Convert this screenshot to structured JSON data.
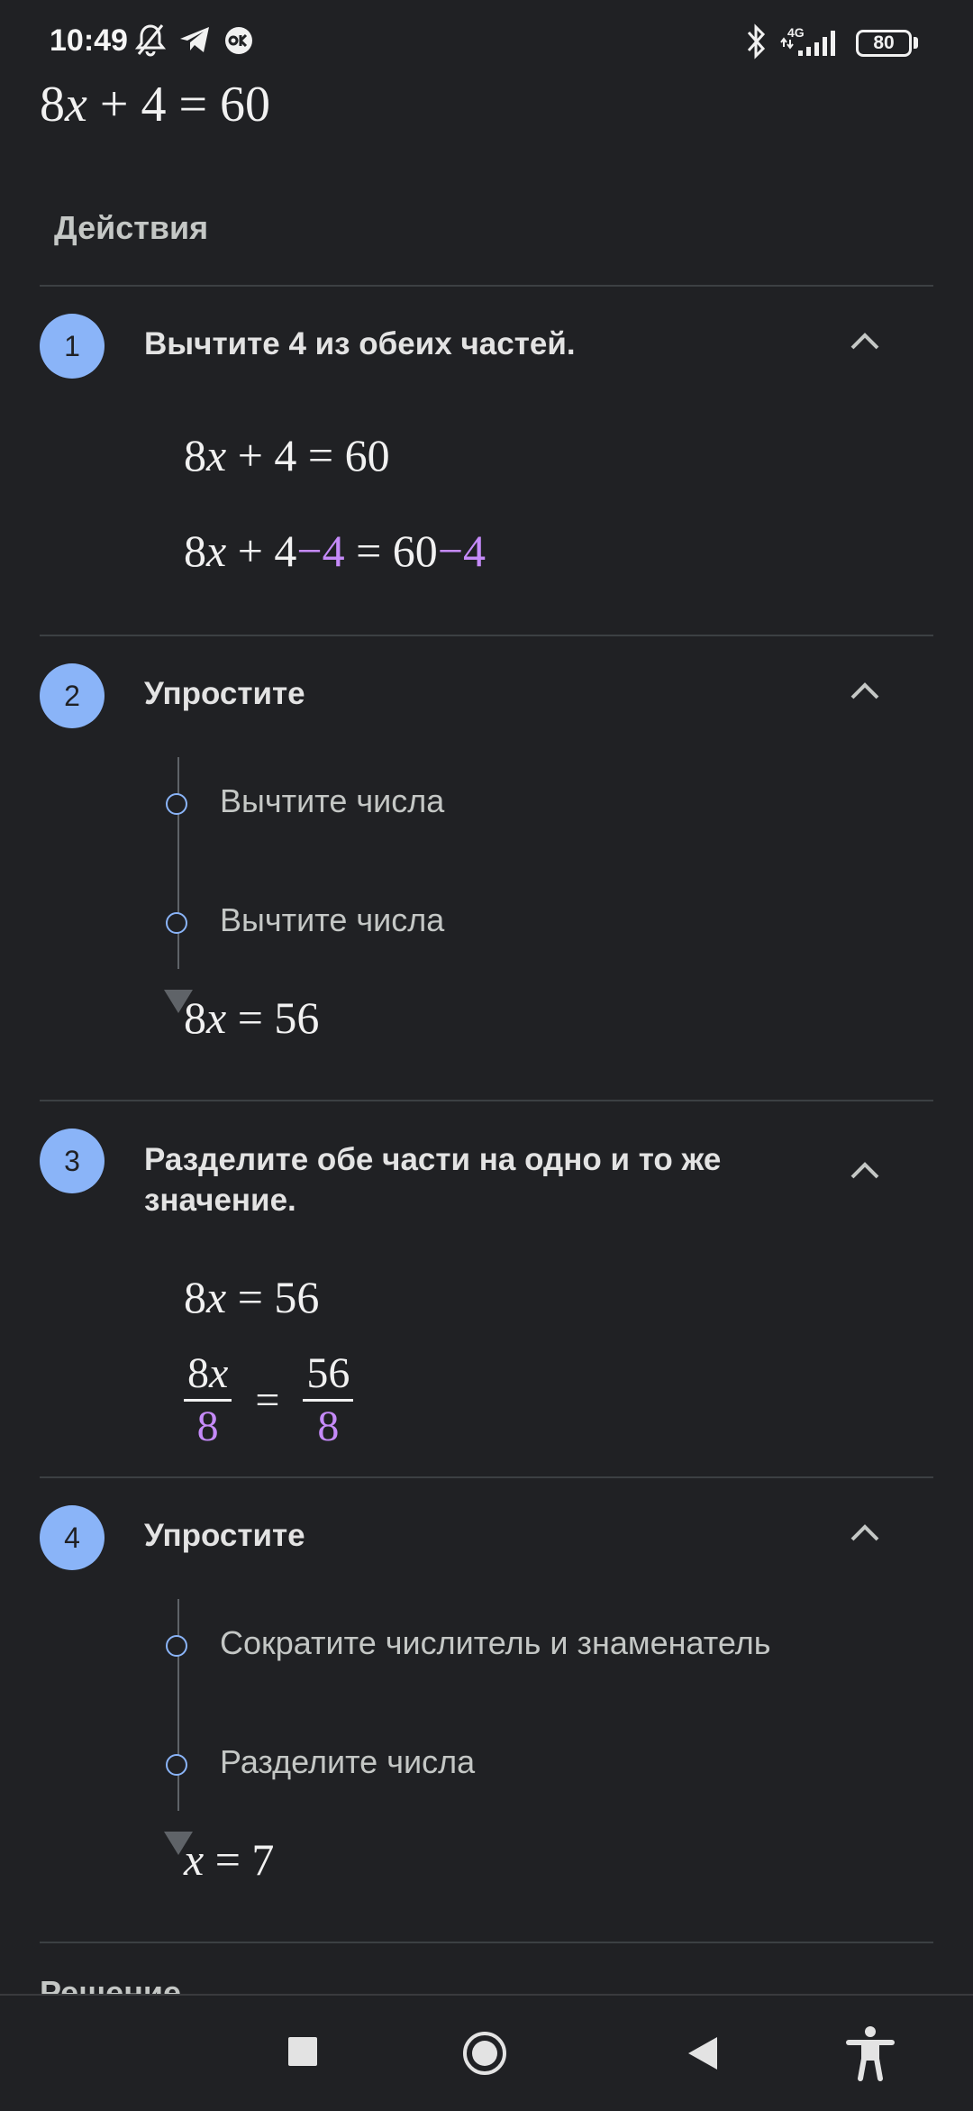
{
  "status_bar": {
    "time": "10:49",
    "network": "4G",
    "battery": "80"
  },
  "equation": "8x + 4 = 60",
  "section_title": "Действия",
  "steps": [
    {
      "number": "1",
      "title": "Вычтите 4 из обеих частей."
    },
    {
      "number": "2",
      "title": "Упростите",
      "substeps": [
        "Вычтите числа",
        "Вычтите числа"
      ]
    },
    {
      "number": "3",
      "title": "Разделите обе части на одно и то же значение."
    },
    {
      "number": "4",
      "title": "Упростите",
      "substeps": [
        "Сократите числитель и знаменатель",
        "Разделите числа"
      ]
    }
  ],
  "math": {
    "s1_line1": {
      "a": "8",
      "x": "x",
      "rest": " + 4 = 60"
    },
    "s1_line2": {
      "a": "8",
      "x": "x",
      "p1": " + 4",
      "h1": "−4",
      "p2": " = 60",
      "h2": "−4"
    },
    "s2_result": {
      "a": "8",
      "x": "x",
      "rest": " = 56"
    },
    "s3_line1": {
      "a": "8",
      "x": "x",
      "rest": " = 56"
    },
    "s3_line2": {
      "num_left": "8",
      "num_left_x": "x",
      "den_left": "8",
      "eq": "=",
      "num_right": "56",
      "den_right": "8"
    },
    "s4_result": {
      "x": "x",
      "rest": " = 7"
    }
  },
  "cut_off_heading": "Решение",
  "colors": {
    "background": "#202124",
    "accent_blue": "#8ab4f8",
    "highlight_purple": "#c58af9"
  },
  "nav_icons": [
    "recents-square-icon",
    "home-circle-icon",
    "back-triangle-icon",
    "accessibility-icon"
  ]
}
